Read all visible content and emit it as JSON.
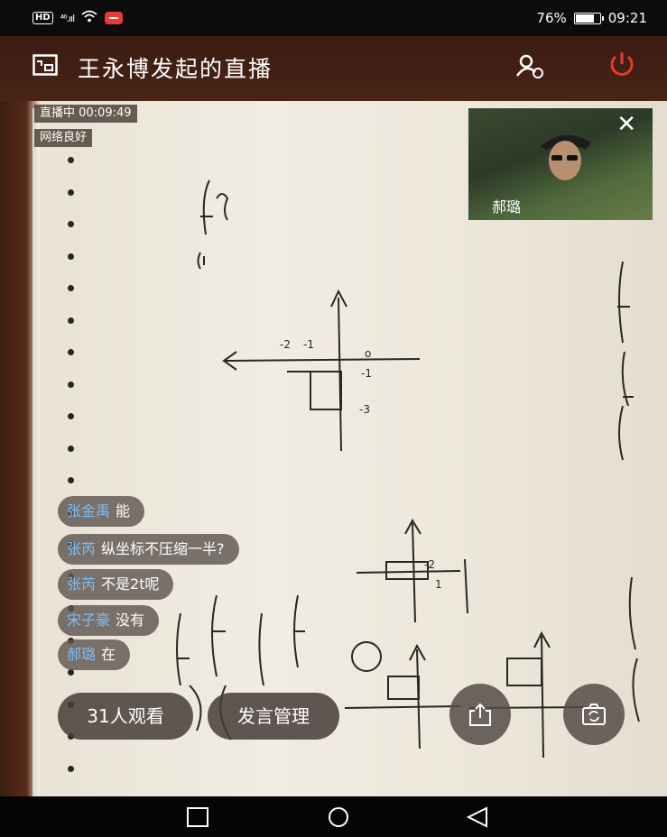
{
  "status_bar": {
    "hd": "HD",
    "network": "⁴⁶.ııl",
    "battery": "76%",
    "battery_level": 0.76,
    "time": "09:21"
  },
  "header": {
    "title": "王永博发起的直播"
  },
  "live": {
    "status": "直播中 00:09:49",
    "network": "网络良好"
  },
  "pip": {
    "name": "郝璐"
  },
  "chat": [
    {
      "name": "张金禹",
      "text": "能"
    },
    {
      "name": "张芮",
      "text": "纵坐标不压缩一半?"
    },
    {
      "name": "张芮",
      "text": "不是2t呢"
    },
    {
      "name": "宋子豪",
      "text": "没有"
    },
    {
      "name": "郝璐",
      "text": "在"
    }
  ],
  "controls": {
    "viewers": "31人观看",
    "speech_manage": "发言管理"
  },
  "icons": {
    "screen": "screen-share-icon",
    "mic": "microphone-settings-icon",
    "power": "power-icon",
    "share": "share-icon",
    "camera": "camera-switch-icon"
  },
  "colors": {
    "power": "#e23b2e",
    "chat_name": "#7dbdf5"
  }
}
